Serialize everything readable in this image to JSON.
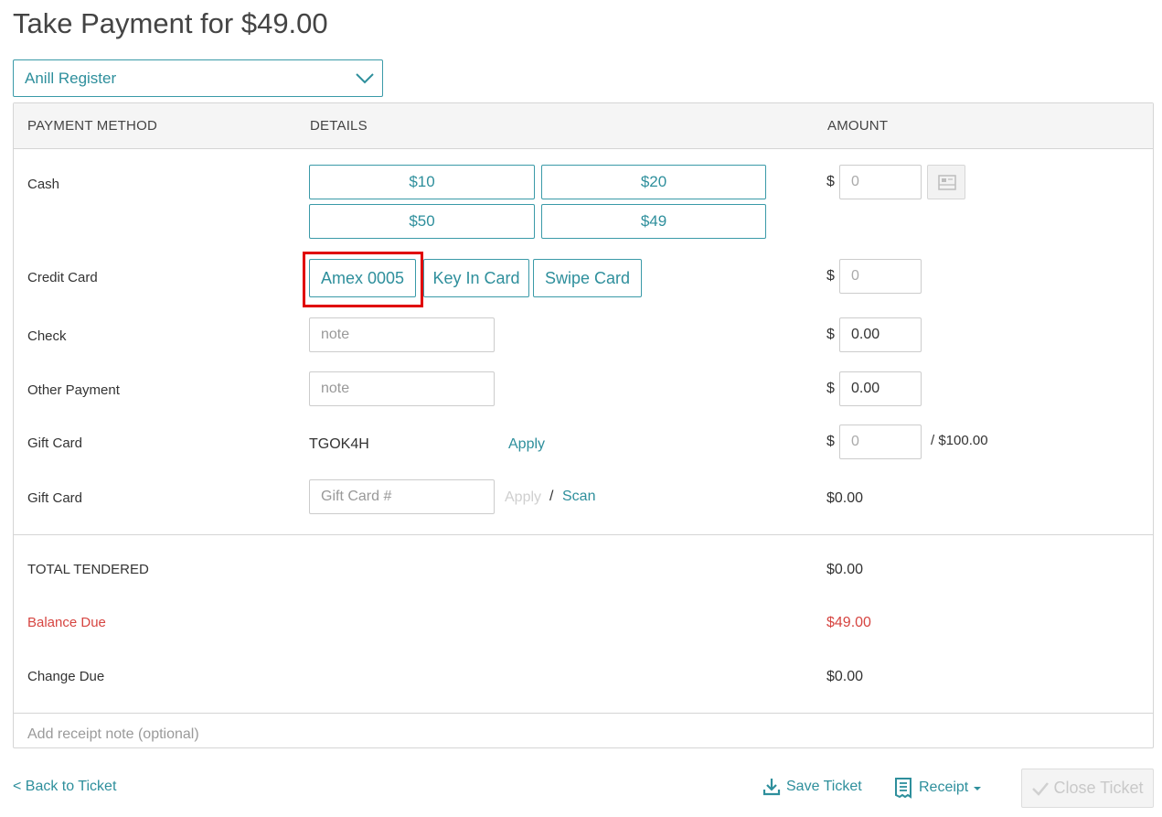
{
  "title": "Take Payment for $49.00",
  "register": {
    "selected": "Anill Register",
    "icon": "chevron-down-icon"
  },
  "table": {
    "headers": {
      "method": "PAYMENT METHOD",
      "details": "DETAILS",
      "amount": "AMOUNT"
    }
  },
  "cash": {
    "label": "Cash",
    "quick_amounts": [
      "$10",
      "$20",
      "$50",
      "$49"
    ],
    "currency": "$",
    "amount_placeholder": "0",
    "drawer_icon": "cash-drawer-icon"
  },
  "credit_card": {
    "label": "Credit Card",
    "buttons": [
      "Amex 0005",
      "Key In Card",
      "Swipe Card"
    ],
    "currency": "$",
    "amount_placeholder": "0"
  },
  "check": {
    "label": "Check",
    "note_placeholder": "note",
    "currency": "$",
    "amount": "0.00"
  },
  "other_payment": {
    "label": "Other Payment",
    "note_placeholder": "note",
    "currency": "$",
    "amount": "0.00"
  },
  "gift_card_1": {
    "label": "Gift Card",
    "code": "TGOK4H",
    "apply_label": "Apply",
    "currency": "$",
    "amount_placeholder": "0",
    "balance": "/ $100.00"
  },
  "gift_card_2": {
    "label": "Gift Card",
    "input_placeholder": "Gift Card #",
    "apply_label": "Apply",
    "separator": "/",
    "scan_label": "Scan",
    "amount": "$0.00"
  },
  "totals": {
    "tendered_label": "TOTAL TENDERED",
    "tendered": "$0.00",
    "balance_label": "Balance Due",
    "balance": "$49.00",
    "change_label": "Change Due",
    "change": "$0.00"
  },
  "receipt_note_placeholder": "Add receipt note (optional)",
  "footer": {
    "back": "< Back to Ticket",
    "save": "Save Ticket",
    "receipt": "Receipt",
    "close": "Close Ticket"
  },
  "colors": {
    "accent": "#2e8f9c",
    "alert": "#d64541",
    "highlight": "#e00000"
  }
}
